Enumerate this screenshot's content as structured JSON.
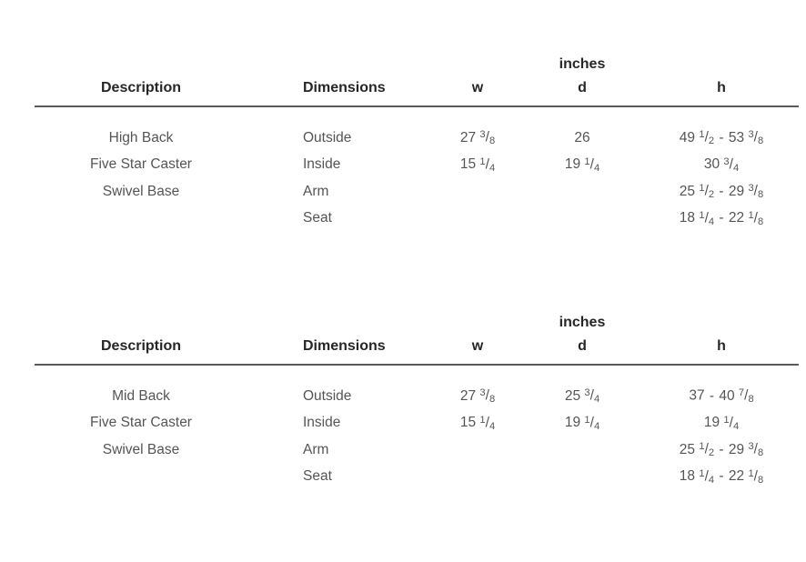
{
  "document": {
    "kind": "product-dimension-spec-sheet",
    "unit_label": "inches"
  },
  "tables": [
    {
      "id": "high-back-chair",
      "unit_label": "inches",
      "columns": {
        "description": "Description",
        "dimensions": "Dimensions",
        "w": "w",
        "d": "d",
        "h": "h"
      },
      "description_lines": [
        "High Back",
        "Five Star Caster",
        "Swivel Base"
      ],
      "rows": [
        {
          "dimension": "Outside",
          "w": {
            "whole": "27",
            "num": "3",
            "den": "8"
          },
          "d": {
            "whole": "26"
          },
          "h_min": {
            "whole": "49",
            "num": "1",
            "den": "2"
          },
          "h_max": {
            "whole": "53",
            "num": "3",
            "den": "8"
          }
        },
        {
          "dimension": "Inside",
          "w": {
            "whole": "15",
            "num": "1",
            "den": "4"
          },
          "d": {
            "whole": "19",
            "num": "1",
            "den": "4"
          },
          "h_min": {
            "whole": "30",
            "num": "3",
            "den": "4"
          },
          "h_max": null
        },
        {
          "dimension": "Arm",
          "w": null,
          "d": null,
          "h_min": {
            "whole": "25",
            "num": "1",
            "den": "2"
          },
          "h_max": {
            "whole": "29",
            "num": "3",
            "den": "8"
          }
        },
        {
          "dimension": "Seat",
          "w": null,
          "d": null,
          "h_min": {
            "whole": "18",
            "num": "1",
            "den": "4"
          },
          "h_max": {
            "whole": "22",
            "num": "1",
            "den": "8"
          }
        }
      ]
    },
    {
      "id": "mid-back-chair",
      "unit_label": "inches",
      "columns": {
        "description": "Description",
        "dimensions": "Dimensions",
        "w": "w",
        "d": "d",
        "h": "h"
      },
      "description_lines": [
        "Mid Back",
        "Five Star Caster",
        "Swivel Base"
      ],
      "rows": [
        {
          "dimension": "Outside",
          "w": {
            "whole": "27",
            "num": "3",
            "den": "8"
          },
          "d": {
            "whole": "25",
            "num": "3",
            "den": "4"
          },
          "h_min": {
            "whole": "37"
          },
          "h_max": {
            "whole": "40",
            "num": "7",
            "den": "8"
          }
        },
        {
          "dimension": "Inside",
          "w": {
            "whole": "15",
            "num": "1",
            "den": "4"
          },
          "d": {
            "whole": "19",
            "num": "1",
            "den": "4"
          },
          "h_min": {
            "whole": "19",
            "num": "1",
            "den": "4"
          },
          "h_max": null
        },
        {
          "dimension": "Arm",
          "w": null,
          "d": null,
          "h_min": {
            "whole": "25",
            "num": "1",
            "den": "2"
          },
          "h_max": {
            "whole": "29",
            "num": "3",
            "den": "8"
          }
        },
        {
          "dimension": "Seat",
          "w": null,
          "d": null,
          "h_min": {
            "whole": "18",
            "num": "1",
            "den": "4"
          },
          "h_max": {
            "whole": "22",
            "num": "1",
            "den": "8"
          }
        }
      ]
    }
  ],
  "separators": {
    "range_dash": "-"
  },
  "colors": {
    "heading_text": "#262626",
    "body_text": "#555555",
    "rule": "#5a5a5a",
    "background": "#ffffff"
  }
}
